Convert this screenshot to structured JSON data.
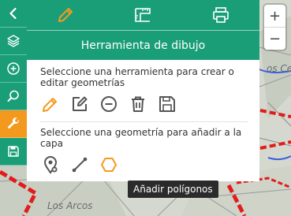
{
  "map": {
    "label_top_right": "os Cerr",
    "label_bottom": "Los Arcos"
  },
  "zoom": {
    "in_label": "+",
    "out_label": "−"
  },
  "sidebar": {
    "items": [
      {
        "name": "back",
        "icon": "chevron-left-icon"
      },
      {
        "name": "layers",
        "icon": "layers-icon"
      },
      {
        "name": "add",
        "icon": "plus-circle-icon"
      },
      {
        "name": "search",
        "icon": "search-icon"
      },
      {
        "name": "tools",
        "icon": "wrench-icon",
        "active": true
      },
      {
        "name": "save",
        "icon": "save-icon"
      }
    ]
  },
  "tabs": [
    {
      "name": "draw",
      "icon": "pencil-icon",
      "active": true
    },
    {
      "name": "measure",
      "icon": "ruler-icon"
    },
    {
      "name": "print",
      "icon": "printer-icon"
    }
  ],
  "panel": {
    "title": "Herramienta de dibujo",
    "section1_text": "Seleccione una herramienta para crear o editar geometrías",
    "section2_text": "Seleccione una geometría para añadir a la capa",
    "tools": [
      "pencil-icon",
      "edit-icon",
      "minus-circle-icon",
      "trash-icon",
      "save-icon"
    ],
    "geometries": [
      "point-icon",
      "line-icon",
      "polygon-icon"
    ]
  },
  "tooltip": {
    "text": "Añadir polígonos"
  },
  "colors": {
    "primary": "#1a9e78",
    "accent": "#f39a1e",
    "panel_bg": "#ffffff",
    "tooltip_bg": "#2b2b2b"
  }
}
